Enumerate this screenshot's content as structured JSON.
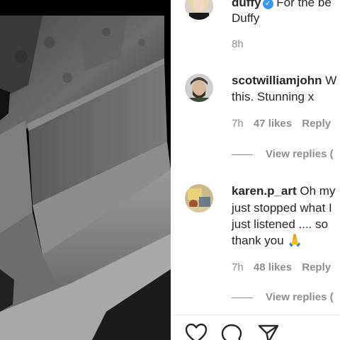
{
  "comments": [
    {
      "username": "duffy",
      "verified": true,
      "line1": "For the be",
      "line2": "Duffy",
      "time": "8h"
    },
    {
      "username": "scotwilliamjohn",
      "line1_rest": "W",
      "line2": "this. Stunning x",
      "time": "7h",
      "likes": "47 likes",
      "reply": "Reply",
      "view_replies": "View replies ("
    },
    {
      "username": "karen.p_art",
      "line1_rest": "Oh my",
      "line2": "just stopped what I",
      "line3": "just listened .... so",
      "line4": "thank you 🙏",
      "time": "7h",
      "likes": "48 likes",
      "reply": "Reply",
      "view_replies": "View replies ("
    }
  ],
  "actions": {
    "like_icon": "heart-icon",
    "comment_icon": "comment-icon",
    "share_icon": "send-icon"
  },
  "colors": {
    "text": "#262626",
    "muted": "#8e8e8e",
    "verified": "#3897f0"
  }
}
